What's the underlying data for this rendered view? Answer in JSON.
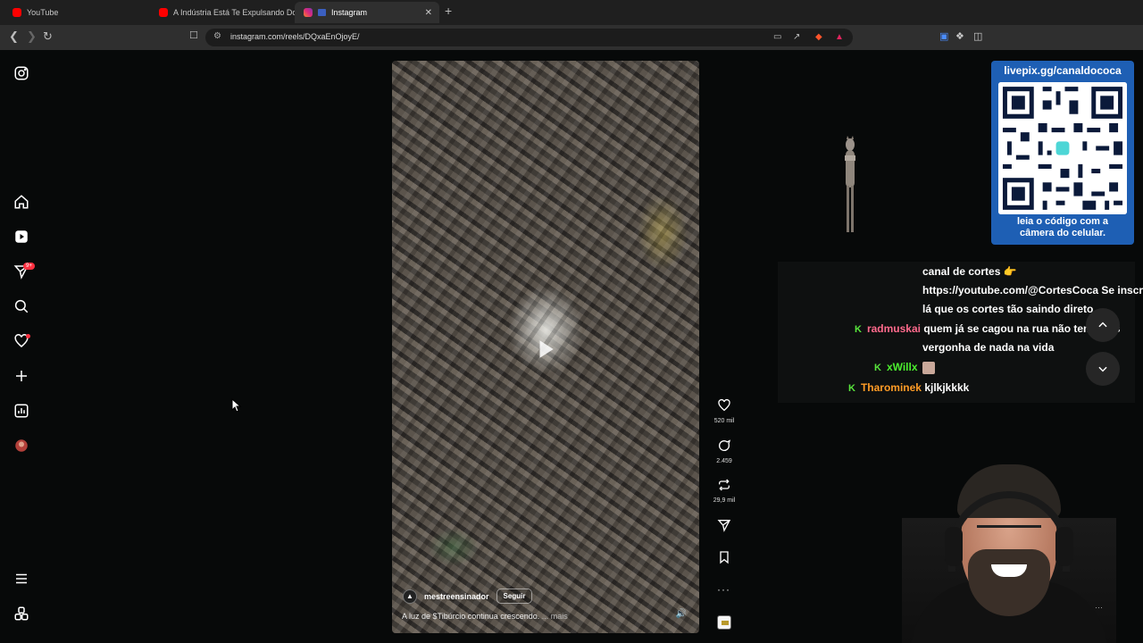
{
  "browser": {
    "tabs": [
      {
        "label": "YouTube",
        "favicon_color": "#ff0000"
      },
      {
        "label": "A Indústria Está Te Expulsando Do G",
        "favicon_color": "#ff0000"
      },
      {
        "label": "Instagram",
        "favicon_color": "#e1306c",
        "active": true
      }
    ],
    "url": "instagram.com/reels/DQxaEnOjoyE/"
  },
  "sidebar": {
    "items": [
      {
        "name": "instagram-logo-icon"
      },
      {
        "name": "home-icon"
      },
      {
        "name": "reels-icon"
      },
      {
        "name": "messages-icon",
        "badge": "9+"
      },
      {
        "name": "search-icon"
      },
      {
        "name": "notifications-icon"
      },
      {
        "name": "create-icon"
      },
      {
        "name": "dashboard-icon"
      },
      {
        "name": "profile-avatar"
      },
      {
        "name": "menu-icon"
      },
      {
        "name": "also-from-meta-icon"
      }
    ]
  },
  "reel": {
    "author": "mestreensinador",
    "follow_label": "Seguir",
    "caption": "A luz de $Tibúrcio continua crescendo.",
    "more_label": "... mais"
  },
  "actions": {
    "likes": "520 mil",
    "comments": "2.459",
    "reposts": "29,9 mil"
  },
  "overlay": {
    "qr_title": "livepix.gg/canaldococa",
    "qr_caption_line1": "leia o código com a",
    "qr_caption_line2": "câmera do celular."
  },
  "chat": {
    "lines": [
      {
        "text": "canal de cortes 👉"
      },
      {
        "text": "https://youtube.com/@CortesCoca Se inscreve"
      },
      {
        "text": "lá que os cortes tão saindo direto."
      },
      {
        "user": "radmuskai",
        "message": "quem já se cagou na rua não tem mais"
      },
      {
        "message": "vergonha de nada na vida"
      },
      {
        "user": "xWillx",
        "message": ""
      },
      {
        "user": "Tharominek",
        "message": "kjlkjkkkk"
      }
    ],
    "badge": "K"
  }
}
